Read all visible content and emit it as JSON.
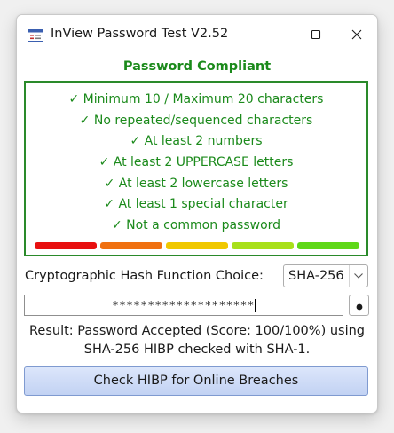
{
  "window": {
    "title": "InView Password Test V2.52",
    "app_icon": "form-app-icon",
    "controls": [
      "minimize-icon",
      "maximize-icon",
      "close-icon"
    ]
  },
  "status": {
    "heading": "Password Compliant",
    "color": "#1b8a1b"
  },
  "criteria": [
    "✓ Minimum 10 / Maximum 20 characters",
    "✓ No repeated/sequenced characters",
    "✓ At least 2 numbers",
    "✓ At least 2 UPPERCASE letters",
    "✓ At least 2 lowercase letters",
    "✓ At least 1 special character",
    "✓ Not a common password"
  ],
  "strength_meter": {
    "level": 1.0,
    "segments": [
      "#e81010",
      "#f07010",
      "#f0c800",
      "#a8e01a",
      "#5fd818"
    ]
  },
  "hash": {
    "label": "Cryptographic Hash Function Choice:",
    "selected": "SHA-256"
  },
  "password": {
    "masked_value": "********************",
    "reveal_icon": "dot-icon"
  },
  "result": {
    "line1": "Result: Password Accepted (Score: 100/100%) using",
    "line2": "SHA-256 HIBP checked with SHA-1."
  },
  "actions": {
    "check_label": "Check HIBP for Online Breaches"
  }
}
